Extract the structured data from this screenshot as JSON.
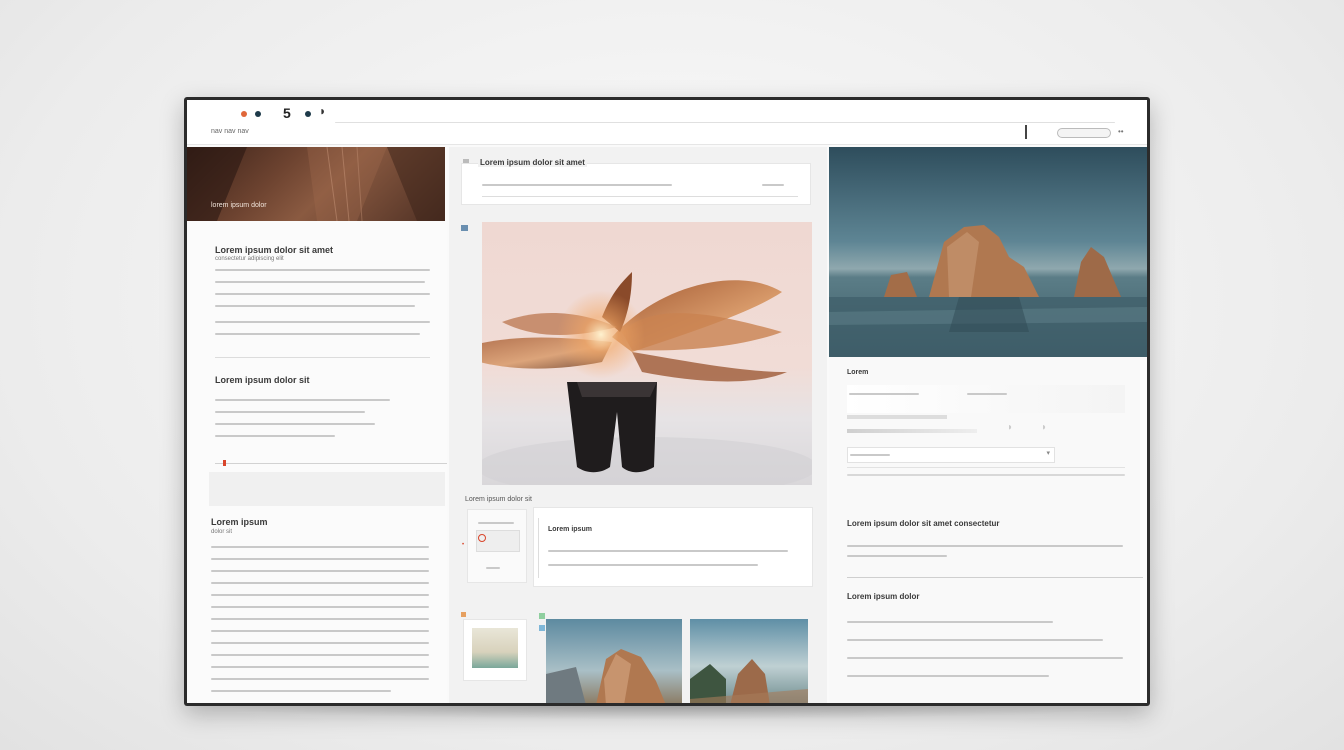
{
  "header": {
    "nav_text": "nav nav nav",
    "window_dots": [
      "#e0673a",
      "#1e3a4a",
      "#1e3a4a"
    ],
    "logo_mark": "5"
  },
  "left_column": {
    "banner_caption": "lorem ipsum dolor",
    "section1": {
      "title": "Lorem ipsum dolor sit amet",
      "subtitle": "consectetur adipiscing elit"
    },
    "section2": {
      "title": "Lorem ipsum dolor sit"
    },
    "section3": {
      "title": "Lorem ipsum",
      "subtitle": "dolor sit"
    },
    "progress_accent": "#d9452b"
  },
  "center_column": {
    "top_card_title": "Lorem ipsum dolor sit amet",
    "caption_row": "Lorem ipsum dolor sit",
    "bottom_card_title": "Lorem ipsum"
  },
  "right_column": {
    "panel_title": "Lorem",
    "section_title_1": "Lorem ipsum dolor sit amet consectetur",
    "section_title_2": "Lorem ipsum dolor"
  },
  "colors": {
    "accent": "#c86a3a",
    "sea": "#3f5e6a",
    "rock": "#b07850"
  }
}
